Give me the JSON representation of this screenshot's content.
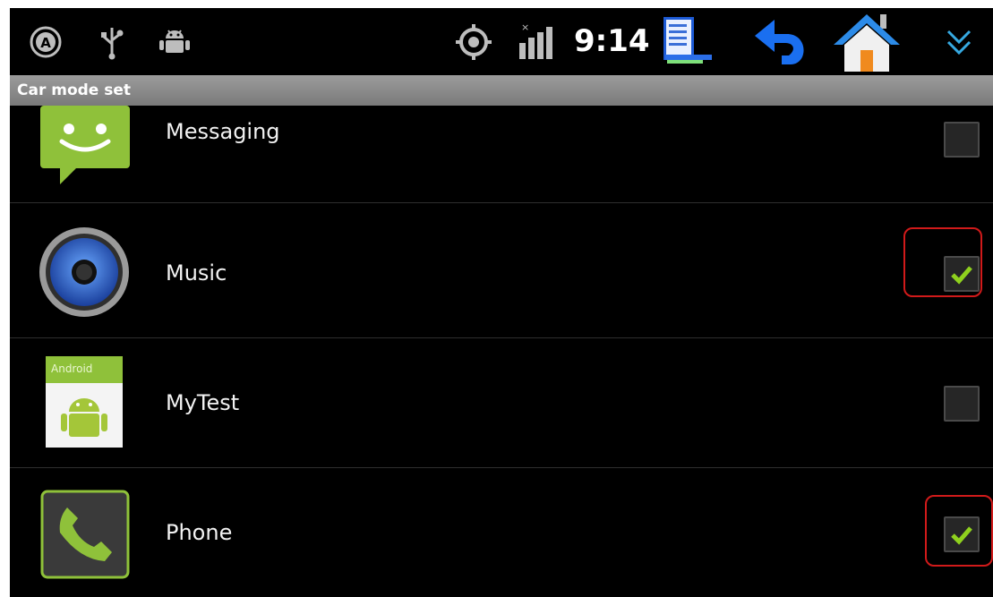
{
  "status_bar": {
    "time": "9:14",
    "icons": [
      "gps-auto-icon",
      "usb-icon",
      "android-debug-icon",
      "location-target-icon",
      "signal-icon",
      "document-notification-icon",
      "back-arrow-icon",
      "home-icon",
      "expand-chevron-icon"
    ]
  },
  "screen_title": "Car mode set",
  "apps": [
    {
      "label": "Messaging",
      "icon": "messaging-icon",
      "checked": false,
      "highlighted": false
    },
    {
      "label": "Music",
      "icon": "music-speaker-icon",
      "checked": true,
      "highlighted": true
    },
    {
      "label": "MyTest",
      "icon": "android-app-icon",
      "checked": false,
      "highlighted": false
    },
    {
      "label": "Phone",
      "icon": "phone-icon",
      "checked": true,
      "highlighted": true
    }
  ],
  "colors": {
    "background": "#000000",
    "title_bar": "#8a8a8a",
    "check_green": "#8fd11e",
    "highlight_red": "#d11a1a"
  }
}
